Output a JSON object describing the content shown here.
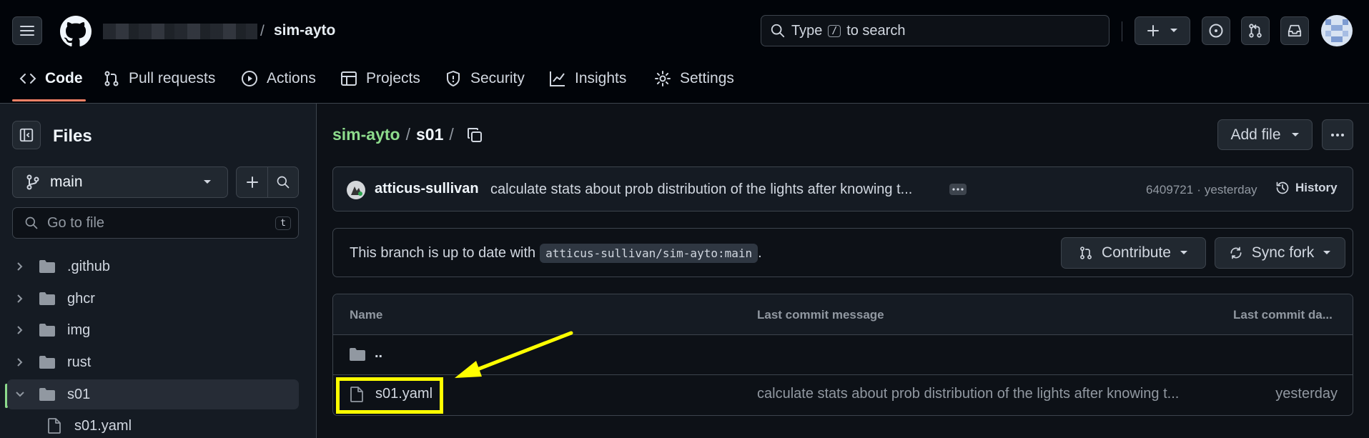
{
  "repo": {
    "owner_redacted": "",
    "name": "sim-ayto"
  },
  "search": {
    "prefix": "Type",
    "key": "/",
    "suffix": "to search"
  },
  "tabs": [
    {
      "label": "Code",
      "icon": "code-icon"
    },
    {
      "label": "Pull requests",
      "icon": "pull-request-icon"
    },
    {
      "label": "Actions",
      "icon": "play-icon"
    },
    {
      "label": "Projects",
      "icon": "table-icon"
    },
    {
      "label": "Security",
      "icon": "shield-icon"
    },
    {
      "label": "Insights",
      "icon": "graph-icon"
    },
    {
      "label": "Settings",
      "icon": "gear-icon"
    }
  ],
  "sidebar": {
    "title": "Files",
    "branch": "main",
    "goto_placeholder": "Go to file",
    "goto_shortcut": "t",
    "tree": [
      {
        "label": ".github",
        "type": "folder",
        "expanded": false
      },
      {
        "label": "ghcr",
        "type": "folder",
        "expanded": false
      },
      {
        "label": "img",
        "type": "folder",
        "expanded": false
      },
      {
        "label": "rust",
        "type": "folder",
        "expanded": false
      },
      {
        "label": "s01",
        "type": "folder",
        "expanded": true
      },
      {
        "label": "s01.yaml",
        "type": "file"
      }
    ]
  },
  "breadcrumb": {
    "repo": "sim-ayto",
    "sep1": "/",
    "dir": "s01",
    "sep2": "/"
  },
  "add_file_label": "Add file",
  "commit": {
    "author": "atticus-sullivan",
    "message": "calculate stats about prob distribution of the lights after knowing t...",
    "sha": "6409721",
    "dot": "·",
    "time": "yesterday",
    "history_label": "History"
  },
  "branch_status": {
    "text": "This branch is up to date with",
    "ref": "atticus-sullivan/sim-ayto:main",
    "period": ".",
    "contribute_label": "Contribute",
    "sync_label": "Sync fork"
  },
  "table": {
    "headers": [
      "Name",
      "Last commit message",
      "Last commit da..."
    ],
    "parent_label": "..",
    "rows": [
      {
        "name": "s01.yaml",
        "message": "calculate stats about prob distribution of the lights after knowing t...",
        "date": "yesterday"
      }
    ]
  },
  "colors": {
    "accent_tab": "#f78166",
    "annotation": "#ffff00",
    "repo_link": "#8ddb8c"
  }
}
